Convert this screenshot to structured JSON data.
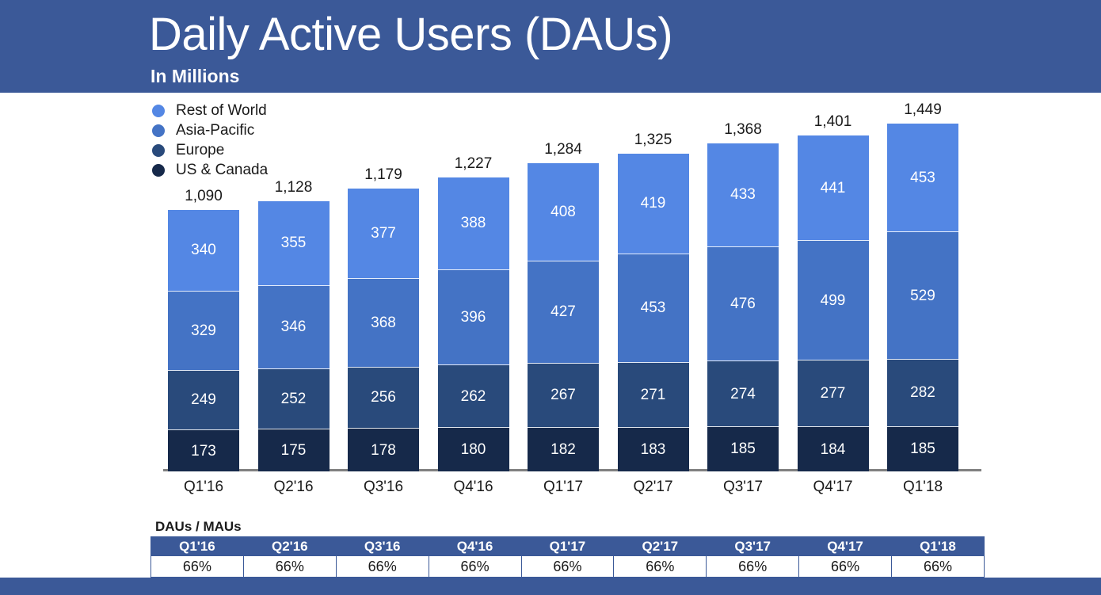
{
  "header": {
    "title": "Daily Active Users (DAUs)",
    "subtitle": "In Millions",
    "band_color": "#3b5998"
  },
  "legend": {
    "items": [
      {
        "label": "Rest of World",
        "color": "#5487e4",
        "icon": "legend-dot-icon"
      },
      {
        "label": "Asia-Pacific",
        "color": "#4473c5",
        "icon": "legend-dot-icon"
      },
      {
        "label": "Europe",
        "color": "#294a7b",
        "icon": "legend-dot-icon"
      },
      {
        "label": "US & Canada",
        "color": "#16294a",
        "icon": "legend-dot-icon"
      }
    ]
  },
  "ratio_table": {
    "title": "DAUs / MAUs",
    "headers": [
      "Q1'16",
      "Q2'16",
      "Q3'16",
      "Q4'16",
      "Q1'17",
      "Q2'17",
      "Q3'17",
      "Q4'17",
      "Q1'18"
    ],
    "values": [
      "66%",
      "66%",
      "66%",
      "66%",
      "66%",
      "66%",
      "66%",
      "66%",
      "66%"
    ],
    "header_bg": "#3b5998"
  },
  "chart_data": {
    "type": "bar",
    "stacked": true,
    "title": "Daily Active Users (DAUs)",
    "subtitle": "In Millions",
    "xlabel": "",
    "ylabel": "",
    "grid": false,
    "legend_position": "top-left",
    "categories": [
      "Q1'16",
      "Q2'16",
      "Q3'16",
      "Q4'16",
      "Q1'17",
      "Q2'17",
      "Q3'17",
      "Q4'17",
      "Q1'18"
    ],
    "series": [
      {
        "name": "US & Canada",
        "color": "#16294a",
        "values": [
          173,
          175,
          178,
          180,
          182,
          183,
          185,
          184,
          185
        ]
      },
      {
        "name": "Europe",
        "color": "#294a7b",
        "values": [
          249,
          252,
          256,
          262,
          267,
          271,
          274,
          277,
          282
        ]
      },
      {
        "name": "Asia-Pacific",
        "color": "#4473c5",
        "values": [
          329,
          346,
          368,
          396,
          427,
          453,
          476,
          499,
          529
        ]
      },
      {
        "name": "Rest of World",
        "color": "#5487e4",
        "values": [
          340,
          355,
          377,
          388,
          408,
          419,
          433,
          441,
          453
        ]
      }
    ],
    "totals": [
      1090,
      1128,
      1179,
      1227,
      1284,
      1325,
      1368,
      1401,
      1449
    ],
    "total_labels": [
      "1,090",
      "1,128",
      "1,179",
      "1,227",
      "1,284",
      "1,325",
      "1,368",
      "1,401",
      "1,449"
    ],
    "segment_labels": [
      [
        "340",
        "329",
        "249",
        "173"
      ],
      [
        "355",
        "346",
        "252",
        "175"
      ],
      [
        "377",
        "368",
        "256",
        "178"
      ],
      [
        "388",
        "396",
        "262",
        "180"
      ],
      [
        "408",
        "427",
        "267",
        "182"
      ],
      [
        "419",
        "453",
        "271",
        "183"
      ],
      [
        "433",
        "476",
        "274",
        "185"
      ],
      [
        "441",
        "499",
        "277",
        "184"
      ],
      [
        "453",
        "529",
        "282",
        "185"
      ]
    ],
    "ylim": [
      0,
      1449
    ],
    "ratio_row": {
      "label": "DAUs / MAUs",
      "values": [
        "66%",
        "66%",
        "66%",
        "66%",
        "66%",
        "66%",
        "66%",
        "66%",
        "66%"
      ]
    }
  }
}
